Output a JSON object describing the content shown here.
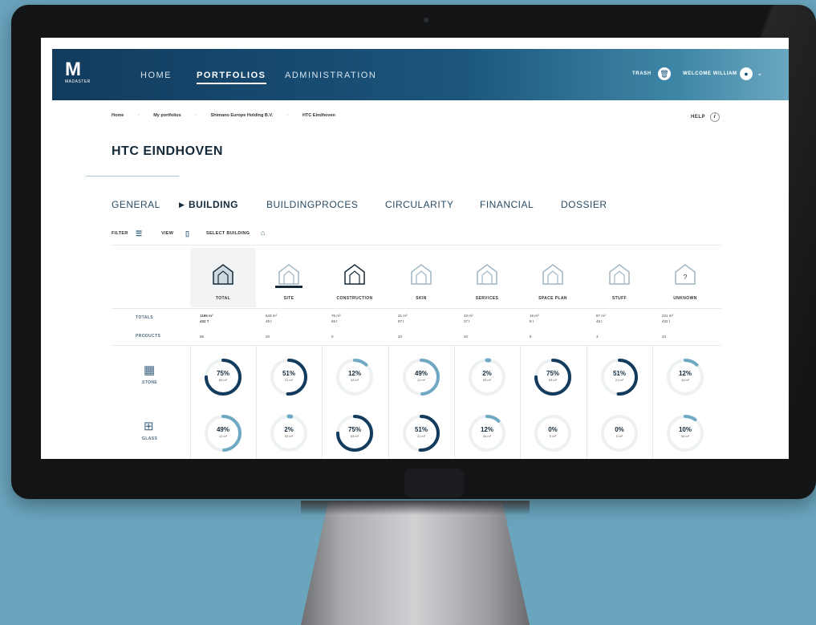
{
  "app": {
    "logo_mark": "M",
    "logo_sub": "MADASTER"
  },
  "nav": {
    "home": "HOME",
    "portfolios": "PORTFOLIOS",
    "administration": "ADMINISTRATION"
  },
  "topright": {
    "trash": "TRASH",
    "welcome": "WELCOME WILLIAM"
  },
  "breadcrumb": [
    "Home",
    "My portfolios",
    "Shimano Europe Holding B.V.",
    "HTC Eindhoven"
  ],
  "breadcrumb_sep": "›",
  "help": "HELP",
  "page_title": "HTC EINDHOVEN",
  "tabs": [
    "GENERAL",
    "BUILDING",
    "BUILDINGPROCES",
    "CIRCULARITY",
    "FINANCIAL",
    "DOSSIER"
  ],
  "active_tab_marker": "▶",
  "toolbar": {
    "filter": "FILTER",
    "view": "VIEW",
    "select_building": "SELECT BUILDING"
  },
  "columns": [
    {
      "label": "TOTAL",
      "totals_m3": "1165 m³",
      "totals_t": "432 T",
      "products": "86"
    },
    {
      "label": "SITE",
      "totals_m3": "643 m³",
      "totals_t": "45 t",
      "products": "20"
    },
    {
      "label": "CONSTRUCTION",
      "totals_m3": "76 m³",
      "totals_t": "65 t",
      "products": "0"
    },
    {
      "label": "SKIN",
      "totals_m3": "21 m³",
      "totals_t": "87 t",
      "products": "20"
    },
    {
      "label": "SERVICES",
      "totals_m3": "43 m³",
      "totals_t": "27 t",
      "products": "20"
    },
    {
      "label": "SPACE PLAN",
      "totals_m3": "16 m³",
      "totals_t": "8 t",
      "products": "8"
    },
    {
      "label": "STUFF",
      "totals_m3": "87 m³",
      "totals_t": "45 t",
      "products": "3"
    },
    {
      "label": "UNKNOWN",
      "totals_m3": "221 m³",
      "totals_t": "432 t",
      "products": "23"
    }
  ],
  "unknown_mark": "?",
  "row_labels": {
    "totals": "TOTALS",
    "products": "PRODUCTS"
  },
  "materials": [
    {
      "name": "STONE",
      "icon": "brick-icon",
      "values": [
        {
          "pct": 75,
          "label": "75%",
          "sub": "83 m³"
        },
        {
          "pct": 51,
          "label": "51%",
          "sub": "21 m³"
        },
        {
          "pct": 12,
          "label": "12%",
          "sub": "34 m³"
        },
        {
          "pct": 49,
          "label": "49%",
          "sub": "12 m³"
        },
        {
          "pct": 2,
          "label": "2%",
          "sub": "53 m³"
        },
        {
          "pct": 75,
          "label": "75%",
          "sub": "83 m³"
        },
        {
          "pct": 51,
          "label": "51%",
          "sub": "21 m³"
        },
        {
          "pct": 12,
          "label": "12%",
          "sub": "34 m³"
        }
      ]
    },
    {
      "name": "GLASS",
      "icon": "window-icon",
      "values": [
        {
          "pct": 49,
          "label": "49%",
          "sub": "12 m³"
        },
        {
          "pct": 2,
          "label": "2%",
          "sub": "53 m³"
        },
        {
          "pct": 75,
          "label": "75%",
          "sub": "83 m³"
        },
        {
          "pct": 51,
          "label": "51%",
          "sub": "21 m³"
        },
        {
          "pct": 12,
          "label": "12%",
          "sub": "34 m³"
        },
        {
          "pct": 0,
          "label": "0%",
          "sub": "0 m³"
        },
        {
          "pct": 0,
          "label": "0%",
          "sub": "0 m³"
        },
        {
          "pct": 10,
          "label": "10%",
          "sub": "54 m³"
        }
      ]
    }
  ],
  "colors": {
    "navy": "#123b5d",
    "accent": "#1b557d",
    "ring_light": "#6fa8c4",
    "ring_track": "#eef1f3"
  }
}
